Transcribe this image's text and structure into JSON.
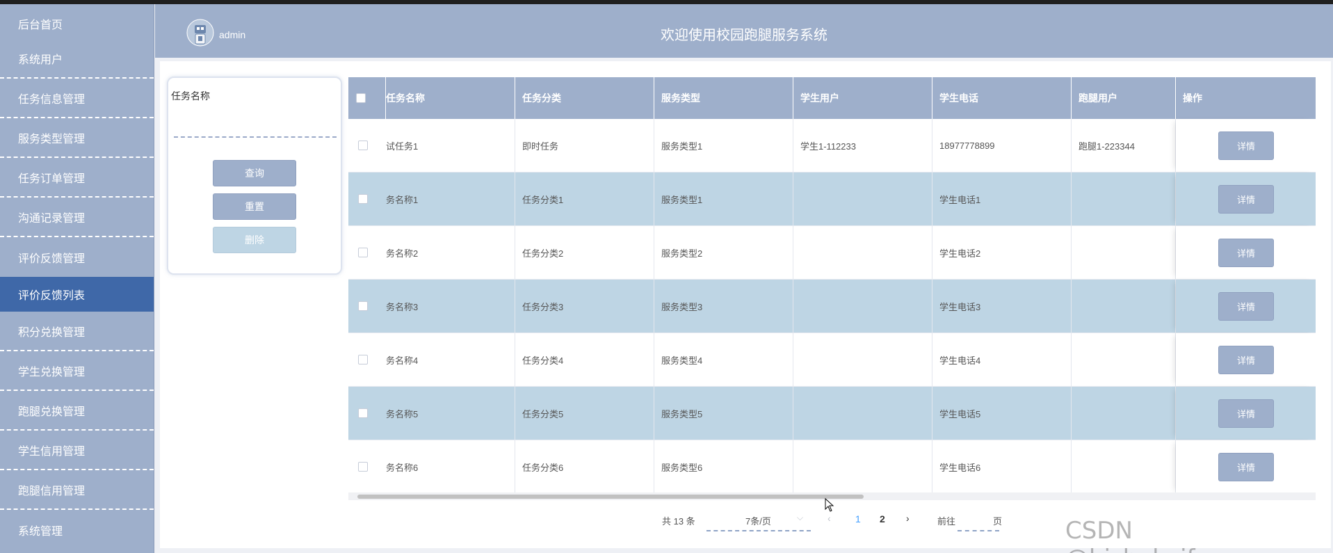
{
  "header": {
    "user": "admin",
    "title": "欢迎使用校园跑腿服务系统"
  },
  "sidebar": {
    "items": [
      {
        "label": "后台首页"
      },
      {
        "label": "系统用户"
      },
      {
        "label": "任务信息管理"
      },
      {
        "label": "服务类型管理"
      },
      {
        "label": "任务订单管理"
      },
      {
        "label": "沟通记录管理"
      },
      {
        "label": "评价反馈管理"
      },
      {
        "label": "评价反馈列表"
      },
      {
        "label": "积分兑换管理"
      },
      {
        "label": "学生兑换管理"
      },
      {
        "label": "跑腿兑换管理"
      },
      {
        "label": "学生信用管理"
      },
      {
        "label": "跑腿信用管理"
      },
      {
        "label": "系统管理"
      }
    ]
  },
  "search": {
    "label": "任务名称",
    "value": "",
    "query_btn": "查询",
    "reset_btn": "重置",
    "delete_btn": "删除"
  },
  "table": {
    "columns": [
      "任务名称",
      "任务分类",
      "服务类型",
      "学生用户",
      "学生电话",
      "跑腿用户",
      "操作"
    ],
    "rows": [
      {
        "name": "试任务1",
        "category": "即时任务",
        "service": "服务类型1",
        "student": "学生1-112233",
        "phone": "18977778899",
        "runner": "跑腿1-223344",
        "action": "详情"
      },
      {
        "name": "务名称1",
        "category": "任务分类1",
        "service": "服务类型1",
        "student": "",
        "phone": "学生电话1",
        "runner": "",
        "action": "详情"
      },
      {
        "name": "务名称2",
        "category": "任务分类2",
        "service": "服务类型2",
        "student": "",
        "phone": "学生电话2",
        "runner": "",
        "action": "详情"
      },
      {
        "name": "务名称3",
        "category": "任务分类3",
        "service": "服务类型3",
        "student": "",
        "phone": "学生电话3",
        "runner": "",
        "action": "详情"
      },
      {
        "name": "务名称4",
        "category": "任务分类4",
        "service": "服务类型4",
        "student": "",
        "phone": "学生电话4",
        "runner": "",
        "action": "详情"
      },
      {
        "name": "务名称5",
        "category": "任务分类5",
        "service": "服务类型5",
        "student": "",
        "phone": "学生电话5",
        "runner": "",
        "action": "详情"
      },
      {
        "name": "务名称6",
        "category": "任务分类6",
        "service": "服务类型6",
        "student": "",
        "phone": "学生电话6",
        "runner": "",
        "action": "详情"
      }
    ]
  },
  "pagination": {
    "total": "共 13 条",
    "page_size": "7条/页",
    "pages": [
      "1",
      "2"
    ],
    "current": "1",
    "goto_label": "前往",
    "page_suffix": "页"
  },
  "watermark": "CSDN @bishekaifayuan",
  "colors": {
    "accent": "#9eafcb",
    "active": "#3f68a8",
    "row_alt": "#bed5e4"
  }
}
